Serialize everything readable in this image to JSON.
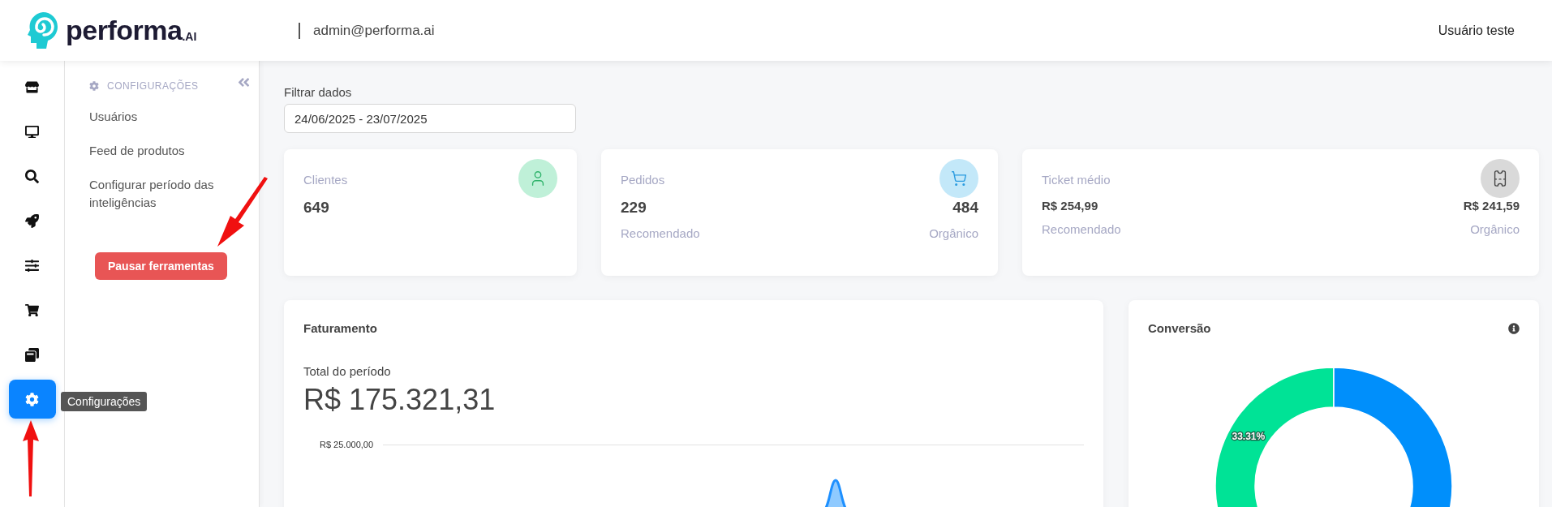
{
  "header": {
    "logo": {
      "name": "performa",
      "suffix": ".AI"
    },
    "email": "admin@performa.ai",
    "user": "Usuário teste"
  },
  "rail": [
    {
      "selected": false
    },
    {
      "selected": false
    },
    {
      "selected": false
    },
    {
      "selected": false
    },
    {
      "selected": false
    },
    {
      "selected": false
    },
    {
      "selected": false
    },
    {
      "selected": true
    }
  ],
  "tooltip": "Configurações",
  "submenu": {
    "title": "CONFIGURAÇÕES",
    "items": [
      "Usuários",
      "Feed de produtos",
      "Configurar período das inteligências"
    ],
    "button": "Pausar ferramentas"
  },
  "filter": {
    "label": "Filtrar dados",
    "value": "24/06/2025 - 23/07/2025"
  },
  "stats": [
    {
      "kind": "single",
      "title": "Clientes",
      "value": "649",
      "color": "#bff0d8"
    },
    {
      "kind": "split",
      "title": "Pedidos",
      "left_value": "229",
      "left_label": "Recomendado",
      "right_value": "484",
      "right_label": "Orgânico",
      "color": "#c3e8f9"
    },
    {
      "kind": "split-money",
      "title": "Ticket médio",
      "left_value": "R$ 254,99",
      "left_label": "Recomendado",
      "right_value": "R$ 241,59",
      "right_label": "Orgânico",
      "color": "#d9d9d9"
    }
  ],
  "revenue": {
    "title": "Faturamento",
    "total_label": "Total do período",
    "total": "R$ 175.321,31",
    "axis_label": "R$ 25.000,00"
  },
  "conversion": {
    "title": "Conversão",
    "chart_data": {
      "type": "donut",
      "values": [
        33.31,
        66.69
      ],
      "value_labels": [
        "33.31%",
        null
      ]
    }
  }
}
